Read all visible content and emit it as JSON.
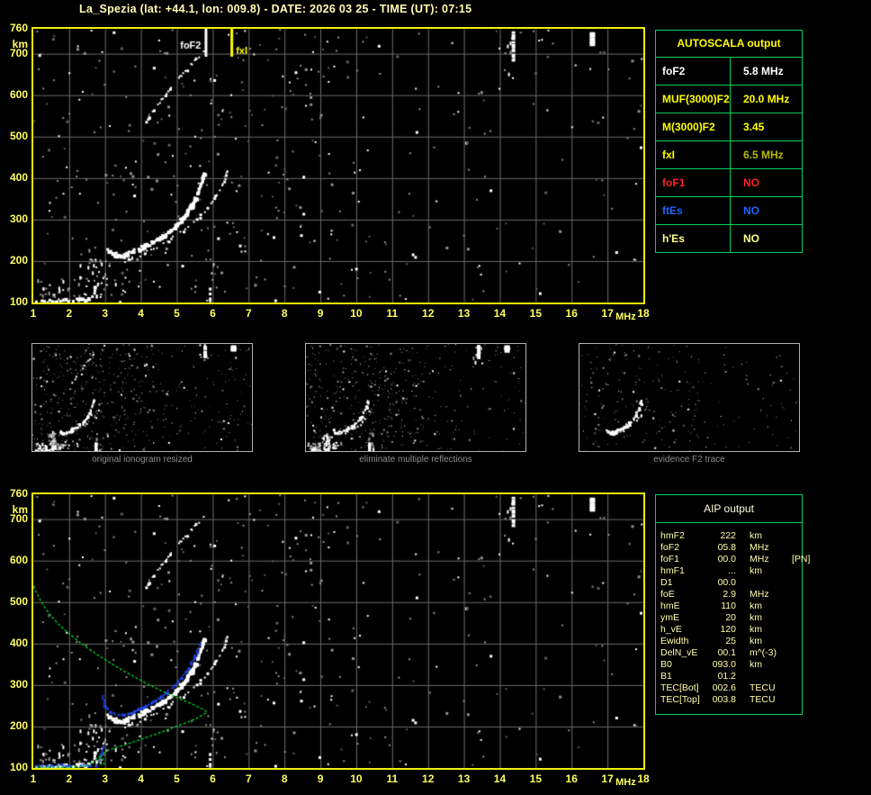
{
  "title": "La_Spezia (lat: +44.1, lon: 009.8) - DATE: 2026 03 25 - TIME (UT): 07:15",
  "colors": {
    "title": "#ffffb4",
    "plot_border": "#f0f000",
    "grid": "#6c6c6c",
    "axis_label": "#ffff60",
    "table_border": "#00d060",
    "autoscala_header": "#ffff00",
    "aip_text": "#ffffaa",
    "aip_header": "#ffffdd",
    "caption": "#8e8e8e",
    "trace_white": "#ffffff",
    "noise_gray": "#8f8f8f",
    "profile_green": "#00cc22",
    "restored_blue": "#2244ee",
    "marker_fof2": "#ffffff",
    "marker_fxi": "#ffff00"
  },
  "axes": {
    "y_unit": "km",
    "x_unit": "MHz",
    "y_tick_km": [
      760,
      700,
      600,
      500,
      400,
      300,
      200,
      100
    ],
    "x_tick_mhz": [
      1,
      2,
      3,
      4,
      5,
      6,
      7,
      8,
      9,
      10,
      11,
      12,
      13,
      14,
      15,
      16,
      17,
      18
    ],
    "x_range": [
      1,
      18
    ],
    "y_range": [
      100,
      760
    ]
  },
  "autoscala_table": {
    "header": "AUTOSCALA output",
    "rows": [
      {
        "label": "foF2",
        "value": "5.8 MHz",
        "label_color": "#ffffff",
        "value_color": "#ffffff"
      },
      {
        "label": "MUF(3000)F2",
        "value": "20.0 MHz",
        "label_color": "#ffff00",
        "value_color": "#ffff00"
      },
      {
        "label": "M(3000)F2",
        "value": "3.45",
        "label_color": "#ffff00",
        "value_color": "#ffff00"
      },
      {
        "label": "fxI",
        "value": "6.5 MHz",
        "label_color": "#ffff00",
        "value_color": "#b9b900"
      },
      {
        "label": "foF1",
        "value": "NO",
        "label_color": "#ff2020",
        "value_color": "#ff2020"
      },
      {
        "label": "ftEs",
        "value": "NO",
        "label_color": "#2065ff",
        "value_color": "#2065ff"
      },
      {
        "label": "h'Es",
        "value": "NO",
        "label_color": "#ffff90",
        "value_color": "#ffff90"
      }
    ]
  },
  "aip_table": {
    "header": "AIP output",
    "rows": [
      {
        "name": "hmF2",
        "value": "222",
        "unit": "km",
        "extra": ""
      },
      {
        "name": "foF2",
        "value": "05.8",
        "unit": "MHz",
        "extra": ""
      },
      {
        "name": "foF1",
        "value": "00.0",
        "unit": "MHz",
        "extra": "[PN]"
      },
      {
        "name": "hmF1",
        "value": "...",
        "unit": "km",
        "extra": ""
      },
      {
        "name": "D1",
        "value": "00.0",
        "unit": "",
        "extra": ""
      },
      {
        "name": "foE",
        "value": "2.9",
        "unit": "MHz",
        "extra": ""
      },
      {
        "name": "hmE",
        "value": "110",
        "unit": "km",
        "extra": ""
      },
      {
        "name": "ymE",
        "value": "20",
        "unit": "km",
        "extra": ""
      },
      {
        "name": "h_vE",
        "value": "120",
        "unit": "km",
        "extra": ""
      },
      {
        "name": "Ewidth",
        "value": "25",
        "unit": "km",
        "extra": ""
      },
      {
        "name": "DelN_vE",
        "value": "00.1",
        "unit": "m^(-3)",
        "extra": ""
      },
      {
        "name": "B0",
        "value": "093.0",
        "unit": "km",
        "extra": ""
      },
      {
        "name": "B1",
        "value": "01.2",
        "unit": "",
        "extra": ""
      },
      {
        "name": "TEC[Bot]",
        "value": "002.6",
        "unit": "TECU",
        "extra": ""
      },
      {
        "name": "TEC[Top]",
        "value": "003.8",
        "unit": "TECU",
        "extra": ""
      }
    ]
  },
  "thumbnails": [
    {
      "caption": "original ionogram resized",
      "noise": 520,
      "traces": [
        "e_bottom",
        "f2_o",
        "f2_x",
        "second_hop"
      ]
    },
    {
      "caption": "eliminate multiple reflections",
      "noise": 450,
      "traces": [
        "e_bottom",
        "f2_o",
        "f2_x"
      ]
    },
    {
      "caption": "evidence F2 trace",
      "noise": 230,
      "traces": [
        "f2_o",
        "f2_x"
      ]
    }
  ],
  "chart_data": {
    "type": "scatter",
    "title": "Ionogram with AUTOSCALA / AIP interpretation",
    "xlabel": "MHz",
    "ylabel": "km",
    "xlim": [
      1,
      18
    ],
    "ylim": [
      100,
      760
    ],
    "grid": true,
    "markers": [
      {
        "label": "foF2",
        "mhz": 5.8,
        "color": "#ffffff",
        "label_side": "left"
      },
      {
        "label": "fxI",
        "mhz": 6.52,
        "color": "#ffff00",
        "label_side": "right"
      }
    ],
    "traces": {
      "e_bottom": {
        "points": [
          [
            1.05,
            104
          ],
          [
            1.2,
            105
          ],
          [
            1.35,
            104
          ],
          [
            1.5,
            106
          ],
          [
            1.62,
            105
          ],
          [
            1.78,
            107
          ],
          [
            1.95,
            106
          ],
          [
            2.1,
            108
          ],
          [
            2.25,
            107
          ],
          [
            2.4,
            109
          ],
          [
            2.52,
            112
          ],
          [
            2.6,
            118
          ],
          [
            2.66,
            126
          ],
          [
            2.7,
            134
          ]
        ]
      },
      "f2_o": {
        "points": [
          [
            3.02,
            230
          ],
          [
            3.1,
            224
          ],
          [
            3.22,
            219
          ],
          [
            3.38,
            216
          ],
          [
            3.55,
            218
          ],
          [
            3.72,
            224
          ],
          [
            3.9,
            231
          ],
          [
            4.08,
            239
          ],
          [
            4.26,
            247
          ],
          [
            4.44,
            255
          ],
          [
            4.62,
            264
          ],
          [
            4.8,
            275
          ],
          [
            4.98,
            290
          ],
          [
            5.12,
            304
          ],
          [
            5.26,
            320
          ],
          [
            5.38,
            337
          ],
          [
            5.5,
            357
          ],
          [
            5.6,
            378
          ],
          [
            5.68,
            398
          ],
          [
            5.74,
            415
          ]
        ]
      },
      "f2_x": {
        "points": [
          [
            3.55,
            200
          ],
          [
            3.75,
            207
          ],
          [
            3.95,
            214
          ],
          [
            4.15,
            222
          ],
          [
            4.35,
            230
          ],
          [
            4.55,
            239
          ],
          [
            4.75,
            249
          ],
          [
            4.95,
            260
          ],
          [
            5.15,
            272
          ],
          [
            5.35,
            286
          ],
          [
            5.55,
            302
          ],
          [
            5.75,
            320
          ],
          [
            5.95,
            340
          ],
          [
            6.1,
            360
          ],
          [
            6.22,
            380
          ],
          [
            6.32,
            400
          ],
          [
            6.4,
            418
          ]
        ]
      },
      "second_hop": {
        "points": [
          [
            4.05,
            530
          ],
          [
            4.2,
            548
          ],
          [
            4.35,
            565
          ],
          [
            4.5,
            582
          ],
          [
            4.65,
            600
          ],
          [
            4.8,
            616
          ],
          [
            4.95,
            632
          ],
          [
            5.1,
            648
          ],
          [
            5.25,
            662
          ],
          [
            5.4,
            676
          ],
          [
            5.52,
            687
          ],
          [
            5.64,
            697
          ],
          [
            5.75,
            706
          ]
        ]
      },
      "blue_e": {
        "points": [
          [
            1.0,
            106
          ],
          [
            1.4,
            106
          ],
          [
            1.8,
            106
          ],
          [
            2.2,
            106
          ],
          [
            2.5,
            106
          ],
          [
            2.72,
            107
          ],
          [
            2.78,
            112
          ],
          [
            2.84,
            122
          ],
          [
            2.89,
            136
          ],
          [
            2.92,
            152
          ],
          [
            2.94,
            164
          ]
        ]
      },
      "blue_f": {
        "points": [
          [
            2.9,
            274
          ],
          [
            2.93,
            262
          ],
          [
            2.97,
            251
          ],
          [
            3.03,
            243
          ],
          [
            3.12,
            236
          ],
          [
            3.24,
            231
          ],
          [
            3.38,
            228
          ],
          [
            3.52,
            228
          ],
          [
            3.66,
            231
          ],
          [
            3.8,
            236
          ],
          [
            3.95,
            242
          ],
          [
            4.1,
            249
          ],
          [
            4.25,
            256
          ],
          [
            4.4,
            264
          ],
          [
            4.55,
            272
          ],
          [
            4.7,
            282
          ],
          [
            4.85,
            294
          ],
          [
            5.0,
            307
          ],
          [
            5.12,
            319
          ],
          [
            5.24,
            333
          ],
          [
            5.36,
            350
          ],
          [
            5.48,
            368
          ],
          [
            5.58,
            386
          ],
          [
            5.66,
            400
          ]
        ]
      },
      "green_profile": {
        "points": [
          [
            1.0,
            538
          ],
          [
            1.15,
            512
          ],
          [
            1.3,
            490
          ],
          [
            1.5,
            466
          ],
          [
            1.7,
            447
          ],
          [
            1.9,
            431
          ],
          [
            2.15,
            413
          ],
          [
            2.4,
            396
          ],
          [
            2.7,
            378
          ],
          [
            3.0,
            361
          ],
          [
            3.3,
            345
          ],
          [
            3.6,
            330
          ],
          [
            3.9,
            316
          ],
          [
            4.2,
            302
          ],
          [
            4.5,
            289
          ],
          [
            4.8,
            277
          ],
          [
            5.1,
            266
          ],
          [
            5.35,
            257
          ],
          [
            5.55,
            249
          ],
          [
            5.7,
            243
          ],
          [
            5.8,
            238
          ],
          [
            5.84,
            234
          ],
          [
            5.6,
            222
          ],
          [
            5.2,
            207
          ],
          [
            4.8,
            194
          ],
          [
            4.4,
            181
          ],
          [
            4.0,
            169
          ],
          [
            3.6,
            157
          ],
          [
            3.3,
            149
          ],
          [
            3.1,
            143
          ],
          [
            2.98,
            137
          ],
          [
            2.9,
            130
          ],
          [
            2.85,
            123
          ],
          [
            2.83,
            117
          ],
          [
            2.86,
            111
          ],
          [
            2.92,
            107
          ],
          [
            2.97,
            110
          ],
          [
            2.97,
            117
          ],
          [
            2.92,
            124
          ],
          [
            2.85,
            127
          ],
          [
            2.76,
            122
          ],
          [
            2.68,
            114
          ],
          [
            2.58,
            108
          ],
          [
            2.45,
            105
          ],
          [
            2.2,
            103
          ],
          [
            1.9,
            102
          ],
          [
            1.5,
            102
          ],
          [
            1.05,
            102
          ]
        ]
      }
    },
    "styles": {
      "e_bottom": {
        "color": "#ffffff",
        "s": 3,
        "step": 3.0,
        "drop": 0.3,
        "jy": 2.0
      },
      "f2_o": {
        "color": "#ffffff",
        "s": 3,
        "step": 2.6,
        "drop": 0.18,
        "jy": 1.6,
        "passes": 2
      },
      "f2_x": {
        "color": "#ffffff",
        "s": 2,
        "step": 3.0,
        "drop": 0.38,
        "jy": 1.4
      },
      "second_hop": {
        "color": "#ffffff",
        "s": 2,
        "step": 3.2,
        "drop": 0.45,
        "jy": 1.2
      },
      "blue_e": {
        "color": "#2244ee",
        "s": 2,
        "step": 2.4,
        "drop": 0.3,
        "jy": 0.8
      },
      "blue_f": {
        "color": "#2244ee",
        "s": 2,
        "step": 2.6,
        "drop": 0.12,
        "jy": 0.8
      }
    },
    "strips": [
      {
        "mhz": 14.38,
        "km": [
          688,
          756
        ],
        "w": 4
      },
      {
        "mhz": 16.58,
        "km": [
          728,
          756
        ],
        "w": 6
      },
      {
        "mhz": 5.93,
        "km": [
          100,
          158
        ],
        "w": 3
      }
    ],
    "clusters": [
      {
        "m": [
          2.2,
          3.0
        ],
        "k": [
          115,
          210
        ],
        "n": 26
      },
      {
        "m": [
          1.1,
          2.2
        ],
        "k": [
          100,
          160
        ],
        "n": 22
      },
      {
        "m": [
          3.0,
          3.7
        ],
        "k": [
          120,
          165
        ],
        "n": 10
      },
      {
        "m": [
          2.5,
          2.75
        ],
        "k": [
          150,
          230
        ],
        "n": 10
      },
      {
        "m": [
          5.8,
          6.2
        ],
        "k": [
          100,
          240
        ],
        "n": 8
      },
      {
        "m": [
          13.9,
          14.6
        ],
        "k": [
          640,
          760
        ],
        "n": 10
      }
    ],
    "derived_values": {
      "foF2_MHz": 5.8,
      "fxI_MHz": 6.5,
      "MUF3000F2_MHz": 20.0,
      "M3000F2": 3.45,
      "hmF2_km": 222,
      "foE_MHz": 2.9,
      "hmE_km": 110,
      "B0_km": 93.0,
      "B1": 1.2,
      "TEC_bot_TECU": 2.6,
      "TEC_top_TECU": 3.8
    }
  }
}
